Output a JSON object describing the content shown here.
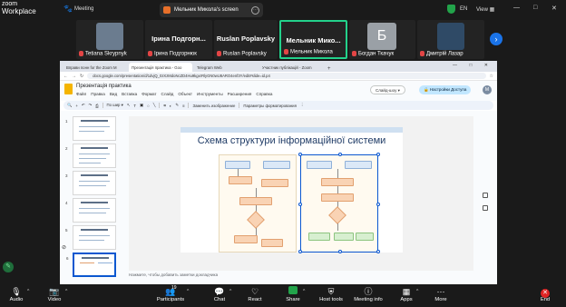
{
  "topbar": {
    "app_line1": "zoom",
    "app_line2": "Workplace",
    "meeting_label": "Meeting",
    "screen_share_label": "Мельник Миколa's screen",
    "language": "EN",
    "view_label": "View",
    "colors": {
      "shield": "#22a34a"
    }
  },
  "participants": [
    {
      "name": "Tetiana Skrypnyk",
      "big_name": ""
    },
    {
      "name": "Ірина Подгорнюк",
      "big_name": "Ірина Подгорн..."
    },
    {
      "name": "Ruslan Poplavsky",
      "big_name": "Ruslan Poplavsky"
    },
    {
      "name": "Мельник Микола",
      "big_name": "Мельник Мико...",
      "active": true
    },
    {
      "name": "Богдан Ткачук",
      "big_name": "",
      "avatar_letter": "Б"
    },
    {
      "name": "Дмитрій Лазар",
      "big_name": ""
    }
  ],
  "browser": {
    "tabs": [
      "Вправи понн for the Zoom M",
      "Презентація практика - Goo",
      "Telegram Web",
      "Участник публікацій - Zoom"
    ],
    "url": "docs.google.com/presentation/d/1dvjQ_0zXzMdoNcZD4Hu9kgxrRlyGN0wU8ARO4enf3Y/edit#slide=id.p4"
  },
  "docs": {
    "title": "Презентація практика",
    "menus": [
      "Файл",
      "Правка",
      "Вид",
      "Вставка",
      "Формат",
      "Слайд",
      "Объект",
      "Инструменты",
      "Расширения",
      "Справка"
    ],
    "slideshow_label": "Слайд-шоу",
    "access_label": "Настройки Доступа",
    "user_initial": "M",
    "toolbar": {
      "fit": "По шир",
      "replace_image": "Заменить изображение",
      "format_params": "Параметры форматирования"
    },
    "slide_title": "Схема структури інформаційної системи",
    "notes_placeholder": "Нажмите, чтобы добавить заметки докладчика",
    "thumb_numbers": [
      "1",
      "2",
      "3",
      "4",
      "5",
      "6"
    ]
  },
  "controls": {
    "audio": "Audio",
    "video": "Video",
    "participants": "Participants",
    "participants_count": "19",
    "chat": "Chat",
    "react": "React",
    "share": "Share",
    "host_tools": "Host tools",
    "meeting_info": "Meeting info",
    "apps": "Apps",
    "more": "More",
    "end": "End"
  }
}
